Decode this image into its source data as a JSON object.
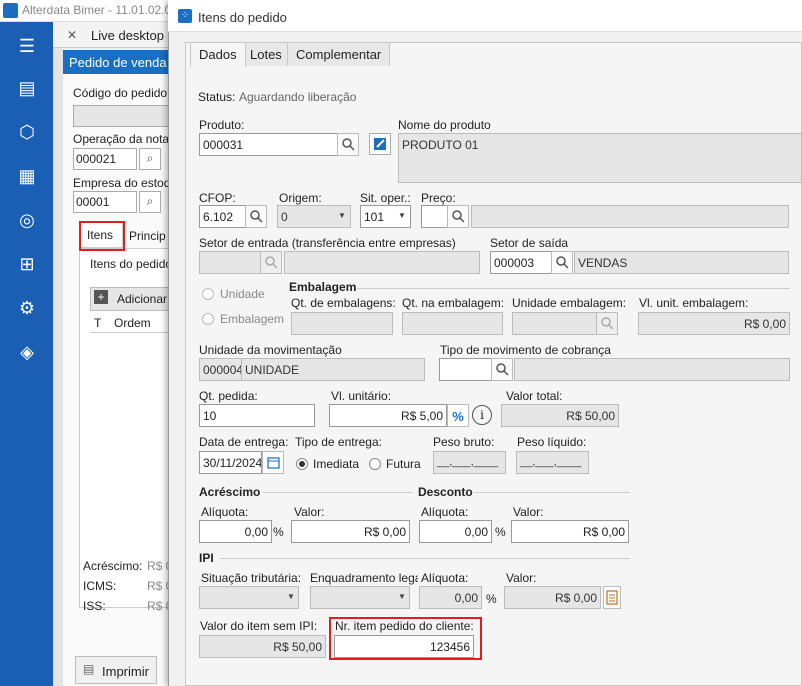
{
  "app": {
    "title": "Alterdata Bimer - 11.01.02.0",
    "tab_label": "Live desktop",
    "subwindow_title": "Pedido de venda (",
    "labels": {
      "codigo": "Código do pedido",
      "operacao": "Operação da nota",
      "empresa": "Empresa do estoq",
      "itens_tab": "Itens",
      "principal_tab": "Princip",
      "itens_do_pedido": "Itens do pedido",
      "adicionar": "Adicionar",
      "col_t": "T",
      "col_ordem": "Ordem",
      "acrescimo": "Acréscimo:",
      "icms": "ICMS:",
      "iss": "ISS:",
      "rs0": "R$ 0",
      "imprimir": "Imprimir"
    },
    "values": {
      "operacao": "000021",
      "empresa": "00001"
    }
  },
  "dialog": {
    "title": "Itens do pedido",
    "tabs": [
      "Dados",
      "Lotes",
      "Complementar"
    ],
    "status_label": "Status:",
    "status_value": "Aguardando liberação",
    "produto_label": "Produto:",
    "produto_value": "000031",
    "nome_label": "Nome do produto",
    "nome_value": "PRODUTO 01",
    "cfop_label": "CFOP:",
    "cfop_value": "6.102",
    "origem_label": "Origem:",
    "origem_value": "0",
    "sitoper_label": "Sit. oper.:",
    "sitoper_value": "101",
    "preco_label": "Preço:",
    "setor_entrada_label": "Setor de entrada (transferência entre empresas)",
    "setor_saida_label": "Setor de saída",
    "setor_saida_code": "000003",
    "setor_saida_name": "VENDAS",
    "embalagem_section": "Embalagem",
    "radio_unidade": "Unidade",
    "radio_embalagem": "Embalagem",
    "qt_embalagens_label": "Qt. de embalagens:",
    "qt_na_embalagem_label": "Qt. na embalagem:",
    "unidade_embalagem_label": "Unidade embalagem:",
    "vl_unit_embalagem_label": "Vl. unit. embalagem:",
    "vl_unit_embalagem_value": "R$ 0,00",
    "unidade_mov_label": "Unidade da movimentação",
    "unidade_mov_code": "000004",
    "unidade_mov_name": "UNIDADE",
    "tipo_cobranca_label": "Tipo de movimento de cobrança",
    "qt_pedida_label": "Qt. pedida:",
    "qt_pedida_value": "10",
    "vl_unitario_label": "Vl. unitário:",
    "vl_unitario_value": "R$ 5,00",
    "percent_symbol": "%",
    "info_symbol": "i",
    "valor_total_label": "Valor total:",
    "valor_total_value": "R$ 50,00",
    "data_entrega_label": "Data de entrega:",
    "data_entrega_value": "30/11/2024",
    "tipo_entrega_label": "Tipo de entrega:",
    "entrega_imediata": "Imediata",
    "entrega_futura": "Futura",
    "peso_bruto_label": "Peso bruto:",
    "peso_bruto_value": "__,___,____",
    "peso_liquido_label": "Peso líquido:",
    "peso_liquido_value": "__,___,____",
    "acrescimo_section": "Acréscimo",
    "desconto_section": "Desconto",
    "aliquota_label": "Alíquota:",
    "valor_label": "Valor:",
    "acrescimo_aliquota": "0,00",
    "acrescimo_valor": "R$ 0,00",
    "desconto_aliquota": "0,00",
    "desconto_valor": "R$ 0,00",
    "ipi_section": "IPI",
    "situacao_tributaria_label": "Situação tributária:",
    "enquadramento_label": "Enquadramento legal",
    "ipi_aliquota_value": "0,00",
    "ipi_valor_value": "R$ 0,00",
    "valor_sem_ipi_label": "Valor do item sem IPI:",
    "valor_sem_ipi_value": "R$ 50,00",
    "nr_item_cliente_label": "Nr. item pedido do cliente:",
    "nr_item_cliente_value": "123456"
  },
  "colors": {
    "sidebar": "#1a5fb4",
    "highlight": "#e01e1e",
    "accent": "#1a6fc4"
  }
}
